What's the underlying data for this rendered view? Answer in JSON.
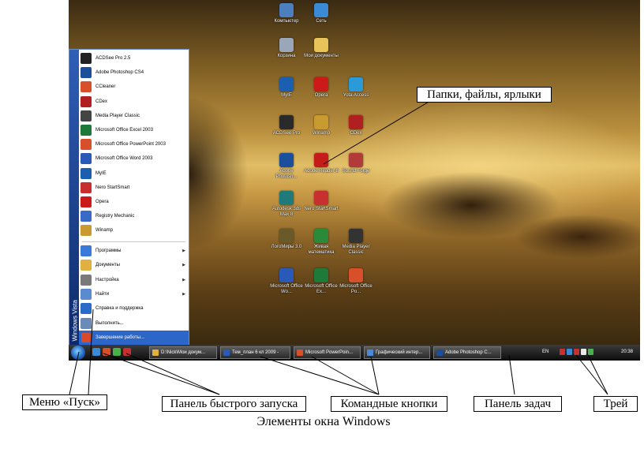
{
  "desktop_icons": [
    {
      "label": "Компьютер",
      "color": "#4d7fbf"
    },
    {
      "label": "Сеть",
      "color": "#3a8ad6"
    },
    {
      "label": "Корзина",
      "color": "#9aa7b8"
    },
    {
      "label": "Мои документы",
      "color": "#e8c35a"
    },
    {
      "label": "MyIE",
      "color": "#1a5fb0"
    },
    {
      "label": "Opera",
      "color": "#cc1a1a"
    },
    {
      "label": "Yota Access",
      "color": "#2a9ad8"
    },
    {
      "label": "ACDSee Pro",
      "color": "#2a2a2a"
    },
    {
      "label": "Winamp",
      "color": "#c89a30"
    },
    {
      "label": "CDex",
      "color": "#b02020"
    },
    {
      "label": "Adobe Photosh...",
      "color": "#1b4f9c"
    },
    {
      "label": "Adobe Reader 8",
      "color": "#c41b1b"
    },
    {
      "label": "Sound Forge",
      "color": "#b23a3a"
    },
    {
      "label": "Autodesk 3ds Max 8",
      "color": "#1f7a7a"
    },
    {
      "label": "Nero StartSmart",
      "color": "#c83030"
    },
    {
      "label": "ЛогоМиры 3.0",
      "color": "#6a5a2a"
    },
    {
      "label": "Живая математика",
      "color": "#2a8a3a"
    },
    {
      "label": "Media Player Classic",
      "color": "#333333"
    },
    {
      "label": "Microsoft Office Wo...",
      "color": "#2a5ab8"
    },
    {
      "label": "Microsoft Office Ex...",
      "color": "#1f7a3a"
    },
    {
      "label": "Microsoft Office Po...",
      "color": "#d8502a"
    }
  ],
  "start_menu": {
    "brand": "Windows Vista",
    "programs": [
      {
        "label": "ACDSee Pro 2.5",
        "color": "#222222"
      },
      {
        "label": "Adobe Photoshop CS4",
        "color": "#1b4f9c"
      },
      {
        "label": "CCleaner",
        "color": "#d8502a"
      },
      {
        "label": "CDex",
        "color": "#b02020"
      },
      {
        "label": "Media Player Classic",
        "color": "#444444"
      },
      {
        "label": "Microsoft Office Excel 2003",
        "color": "#1f7a3a"
      },
      {
        "label": "Microsoft Office PowerPoint 2003",
        "color": "#d8502a"
      },
      {
        "label": "Microsoft Office Word 2003",
        "color": "#2a5ab8"
      },
      {
        "label": "MyIE",
        "color": "#1a5fb0"
      },
      {
        "label": "Nero StartSmart",
        "color": "#c83030"
      },
      {
        "label": "Opera",
        "color": "#cc1a1a"
      },
      {
        "label": "Registry Mechanic",
        "color": "#3a6ac8"
      },
      {
        "label": "Winamp",
        "color": "#c89a30"
      }
    ],
    "system": [
      {
        "label": "Программы",
        "arrow": "▶",
        "color": "#3a7ad8"
      },
      {
        "label": "Документы",
        "arrow": "▶",
        "color": "#e0b040"
      },
      {
        "label": "Настройка",
        "arrow": "▶",
        "color": "#7a7a7a"
      },
      {
        "label": "Найти",
        "arrow": "▶",
        "color": "#5a8ad0"
      },
      {
        "label": "Справка и поддержка",
        "arrow": "",
        "color": "#2a6ac8"
      },
      {
        "label": "Выполнить...",
        "arrow": "",
        "color": "#6a8ab8"
      }
    ],
    "shutdown": "Завершение работы..."
  },
  "taskbar": {
    "buttons": [
      {
        "label": "D:\\Nick\\Мои докум...",
        "color": "#e0b040"
      },
      {
        "label": "Тем_план 6 кл 2009 -",
        "color": "#2a5ab8"
      },
      {
        "label": "Microsoft PowerPoin...",
        "color": "#d8502a"
      },
      {
        "label": "Графический интер...",
        "color": "#4a8ad8"
      },
      {
        "label": "Adobe Photoshop C...",
        "color": "#1b4f9c"
      }
    ],
    "language": "EN",
    "clock": "20:38",
    "quicklaunch_colors": [
      "#3a8ad8",
      "#d8502a",
      "#4ab04a",
      "#c83030"
    ],
    "tray_colors": [
      "#c83030",
      "#3a8ad8",
      "#c83030",
      "#e8e8e8",
      "#4ab04a"
    ]
  },
  "annotations": {
    "files": "Папки, файлы, ярлыки",
    "start": "Меню «Пуск»",
    "quicklaunch": "Панель быстрого запуска",
    "command_buttons": "Командные кнопки",
    "taskbar": "Панель задач",
    "tray": "Трей"
  },
  "caption": "Элементы окна Windows"
}
